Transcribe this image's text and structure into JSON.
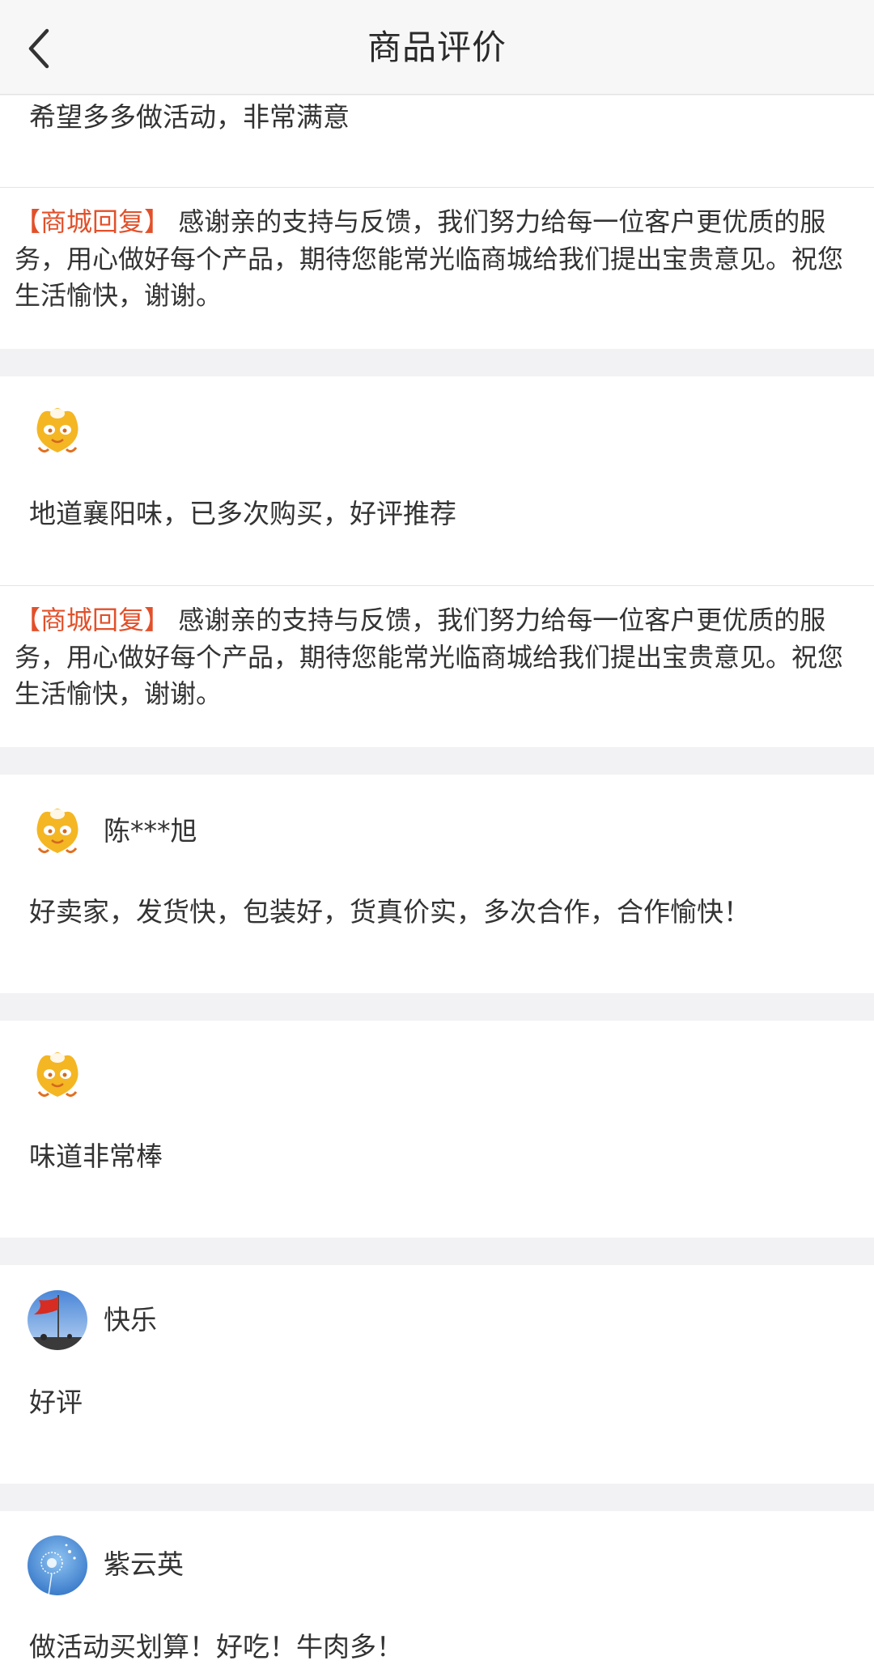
{
  "header": {
    "title": "商品评价",
    "back_icon": "chevron-left-icon"
  },
  "reply_prefix": "【商城回复】",
  "reviews": [
    {
      "user": "",
      "avatar": "mascot-avatar-icon",
      "text": "希望多多做活动，非常满意",
      "reply": "感谢亲的支持与反馈，我们努力给每一位客户更优质的服务，用心做好每个产品，期待您能常光临商城给我们提出宝贵意见。祝您生活愉快，谢谢。"
    },
    {
      "user": "",
      "avatar": "mascot-avatar-icon",
      "text": "地道襄阳味，已多次购买，好评推荐",
      "reply": "感谢亲的支持与反馈，我们努力给每一位客户更优质的服务，用心做好每个产品，期待您能常光临商城给我们提出宝贵意见。祝您生活愉快，谢谢。"
    },
    {
      "user": "陈***旭",
      "avatar": "mascot-avatar-icon",
      "text": "好卖家，发货快，包装好，货真价实，多次合作，合作愉快！"
    },
    {
      "user": "",
      "avatar": "mascot-avatar-icon",
      "text": "味道非常棒"
    },
    {
      "user": "快乐",
      "avatar": "flag-photo-avatar",
      "text": "好评"
    },
    {
      "user": "紫云英",
      "avatar": "dandelion-photo-avatar",
      "text": "做活动买划算！好吃！牛肉多！"
    }
  ],
  "colors": {
    "reply_accent": "#e2502a",
    "page_background": "#f2f2f4",
    "card_background": "#ffffff"
  }
}
